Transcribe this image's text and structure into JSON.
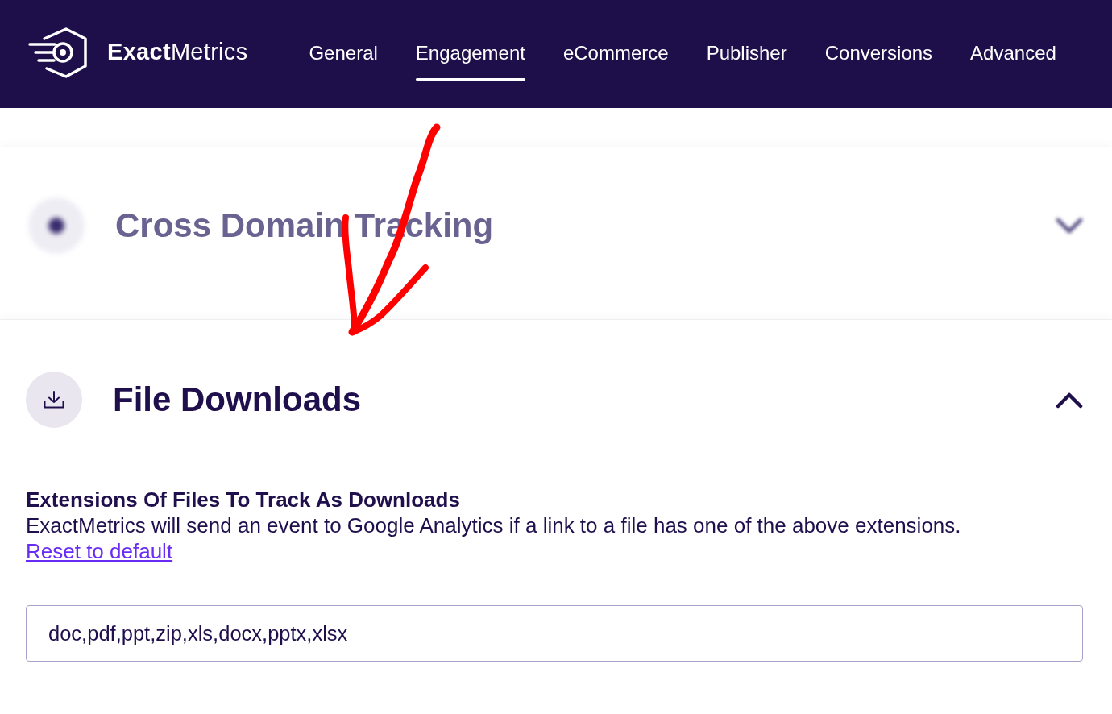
{
  "header": {
    "logo": "**Exact**Metrics",
    "tabs": [
      {
        "label": "General",
        "selected": false
      },
      {
        "label": "Engagement",
        "selected": true
      },
      {
        "label": "eCommerce",
        "selected": false
      },
      {
        "label": "Publisher",
        "selected": false
      },
      {
        "label": "Conversions",
        "selected": false
      },
      {
        "label": "Advanced",
        "selected": false
      }
    ]
  },
  "sections": [
    {
      "kind": "dot",
      "title": "Cross Domain Tracking",
      "expanded": false,
      "blurred": true
    },
    {
      "kind": "download",
      "title": "File Downloads",
      "expanded": true,
      "blurred": false,
      "setting": {
        "label": "Extensions Of Files To Track As Downloads",
        "description": "ExactMetrics will send an event to Google Analytics if a link to a file has one of the above extensions.",
        "link": "Reset to default",
        "value": "doc,pdf,ppt,zip,xls,docx,pptx,xlsx"
      }
    }
  ],
  "annotation": {
    "kind": "arrow"
  }
}
